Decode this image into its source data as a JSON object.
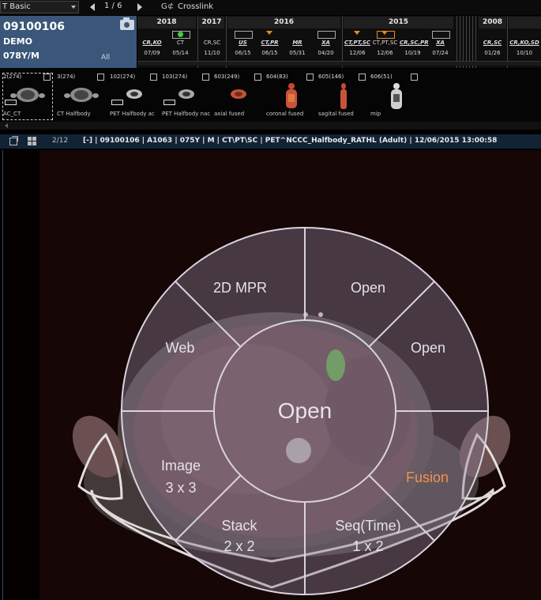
{
  "toolbar": {
    "layout_value": "T Basic",
    "page": "1 / 6",
    "crosslink_icon": "G⊄",
    "crosslink_label": "Crosslink"
  },
  "patient": {
    "id": "09100106",
    "name": "DEMO",
    "age_sex": "078Y/M",
    "all_label": "All"
  },
  "timeline": {
    "years": [
      {
        "label": "2018"
      },
      {
        "label": "2017"
      },
      {
        "label": "2016"
      },
      {
        "label": "2015"
      },
      {
        "label": "2008"
      }
    ],
    "studies": [
      {
        "modality": "CR,KO",
        "date": "07/09"
      },
      {
        "modality": "CT",
        "date": "05/14"
      },
      {
        "modality": "CR,SC",
        "date": "11/10"
      },
      {
        "modality": "US",
        "date": "06/15"
      },
      {
        "modality": "CT,PR",
        "date": "06/15"
      },
      {
        "modality": "MR",
        "date": "05/31"
      },
      {
        "modality": "XA",
        "date": "04/20"
      },
      {
        "modality": "CT,PT,SC",
        "date": "12/06"
      },
      {
        "modality": "CT,PT,SC",
        "date": "12/06"
      },
      {
        "modality": "CR,SC,PR",
        "date": "10/19"
      },
      {
        "modality": "XA",
        "date": "07/24"
      },
      {
        "modality": "CR,SC",
        "date": "01/26"
      },
      {
        "modality": "CR,KO,SD",
        "date": "10/10"
      }
    ]
  },
  "series": [
    {
      "header": "2(274)",
      "label": "AC_CT"
    },
    {
      "header": "3(274)",
      "label": "CT Halfbody"
    },
    {
      "header": "102(274)",
      "label": "PET Halfbody ac"
    },
    {
      "header": "103(274)",
      "label": "PET Halfbody nac"
    },
    {
      "header": "603(249)",
      "label": "axial fused"
    },
    {
      "header": "604(83)",
      "label": "coronal fused"
    },
    {
      "header": "605(146)",
      "label": "sagital fused"
    },
    {
      "header": "606(51)",
      "label": "mip"
    }
  ],
  "viewer": {
    "count": "2/12",
    "info": "[-] | 09100106 | A1063 | 075Y | M | CT\\PT\\SC | PET^NCCC_Halfbody_RATHL (Adult) | 12/06/2015 13:00:58"
  },
  "radial_menu": {
    "center": "Open",
    "segments": [
      {
        "label": "2D MPR"
      },
      {
        "label": "Open"
      },
      {
        "label": "Web"
      },
      {
        "label": "Open"
      },
      {
        "label": "Image",
        "sub": "3 x 3"
      },
      {
        "label": "Fusion"
      },
      {
        "label": "Stack",
        "sub": "2 x 2"
      },
      {
        "label": "Seq(Time)",
        "sub": "1 x 2"
      }
    ],
    "highlight_color": "#f0934a"
  }
}
